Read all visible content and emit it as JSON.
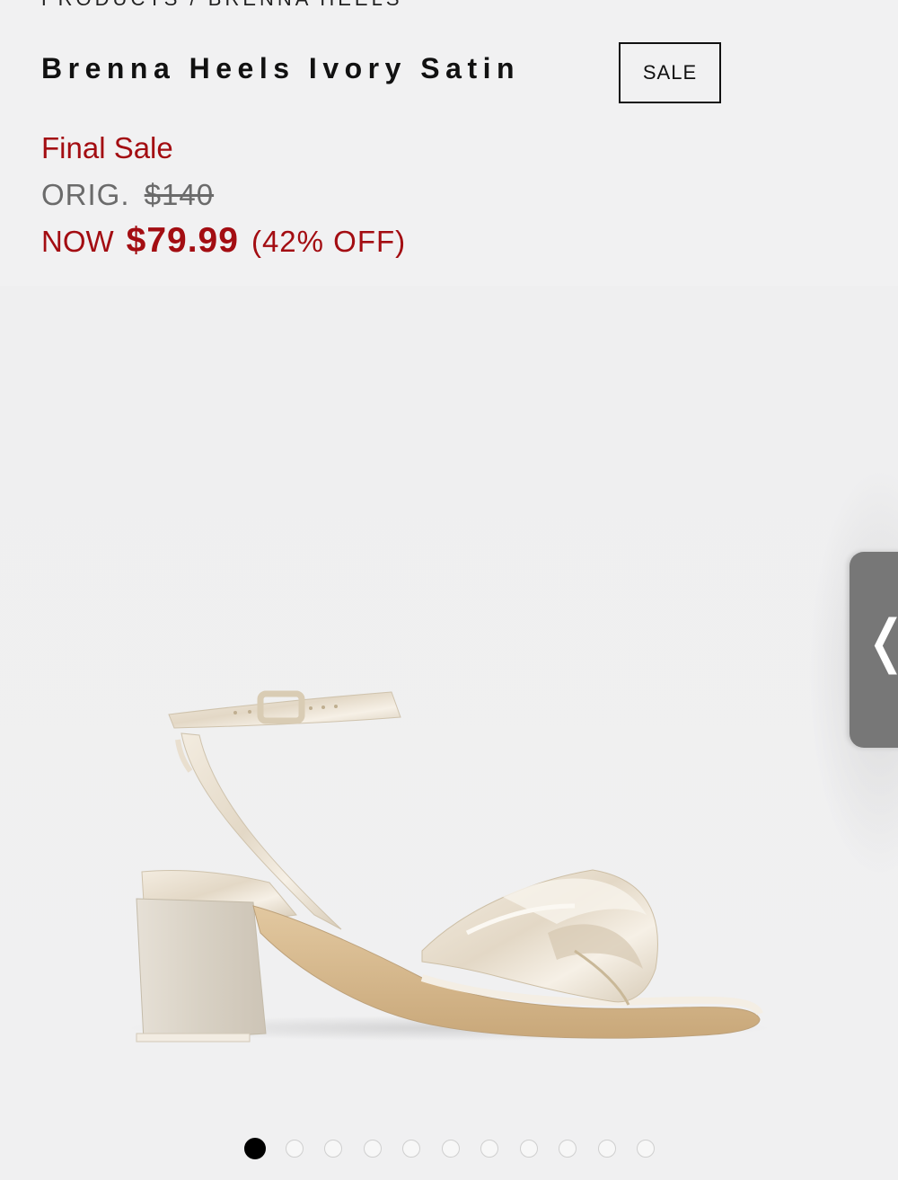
{
  "breadcrumb": "PRODUCTS / BRENNA HEELS",
  "product": {
    "title": "Brenna Heels Ivory Satin",
    "badge": "SALE"
  },
  "pricing": {
    "final_sale": "Final Sale",
    "orig_label": "ORIG.",
    "orig_price": "$140",
    "now_label": "NOW",
    "now_price": "$79.99",
    "discount": "(42% OFF)"
  },
  "gallery": {
    "image_count": 11,
    "active_index": 0,
    "side_tab_glyph": "❬"
  },
  "colors": {
    "sale_red": "#a30d12",
    "background": "#f1f1f2",
    "tab_gray": "#777777"
  }
}
